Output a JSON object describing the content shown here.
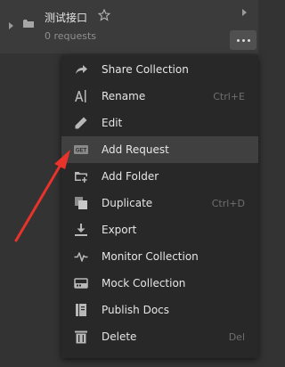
{
  "collection": {
    "name": "测试接口",
    "subtitle": "0 requests"
  },
  "menu": {
    "items": [
      {
        "label": "Share Collection",
        "shortcut": "",
        "icon": "share-icon"
      },
      {
        "label": "Rename",
        "shortcut": "Ctrl+E",
        "icon": "rename-icon"
      },
      {
        "label": "Edit",
        "shortcut": "",
        "icon": "edit-icon"
      },
      {
        "label": "Add Request",
        "shortcut": "",
        "icon": "get-request-icon",
        "icon_text": "GET",
        "highlighted": true
      },
      {
        "label": "Add Folder",
        "shortcut": "",
        "icon": "add-folder-icon"
      },
      {
        "label": "Duplicate",
        "shortcut": "Ctrl+D",
        "icon": "duplicate-icon"
      },
      {
        "label": "Export",
        "shortcut": "",
        "icon": "export-icon"
      },
      {
        "label": "Monitor Collection",
        "shortcut": "",
        "icon": "monitor-icon"
      },
      {
        "label": "Mock Collection",
        "shortcut": "",
        "icon": "mock-icon"
      },
      {
        "label": "Publish Docs",
        "shortcut": "",
        "icon": "publish-docs-icon"
      },
      {
        "label": "Delete",
        "shortcut": "Del",
        "icon": "delete-icon"
      }
    ]
  },
  "colors": {
    "background": "#333333",
    "menu_background": "#282828",
    "highlight": "#404040",
    "annotation_arrow": "#e8332a"
  }
}
